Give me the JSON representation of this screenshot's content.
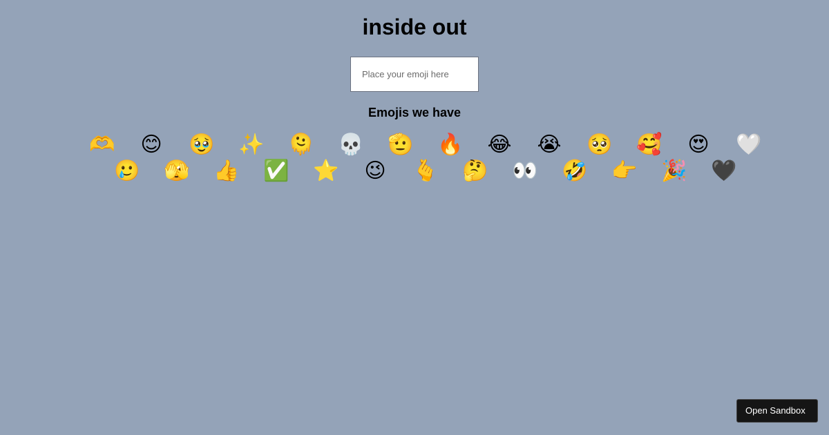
{
  "header": {
    "title": "inside out"
  },
  "input": {
    "placeholder": "Place your emoji here",
    "value": ""
  },
  "section": {
    "heading": "Emojis we have"
  },
  "emojis": [
    "🫶",
    "😊",
    "🥹",
    "✨",
    "🫠",
    "💀",
    "🫡",
    "🔥",
    "😂",
    "😭",
    "🥺",
    "🥰",
    "😍",
    "🤍",
    "🥲",
    "🫣",
    "👍",
    "✅",
    "⭐",
    "😉",
    "🫰",
    "🤔",
    "👀",
    "🤣",
    "👉",
    "🎉",
    "🖤"
  ],
  "footer": {
    "sandbox_label": "Open Sandbox"
  },
  "colors": {
    "background": "#94a3b8",
    "button_bg": "#151515"
  }
}
